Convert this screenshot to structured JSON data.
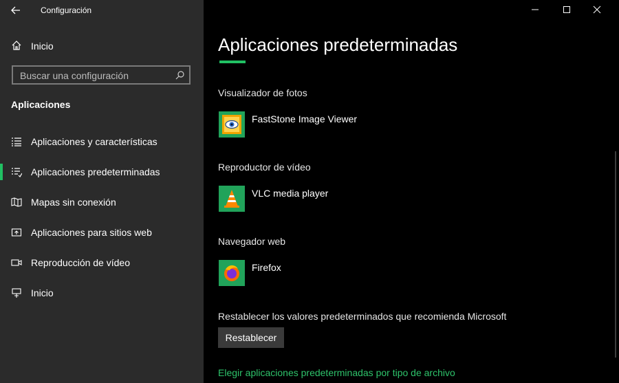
{
  "window": {
    "title": "Configuración",
    "controls": [
      "minimize",
      "maximize",
      "close"
    ]
  },
  "sidebar": {
    "home_label": "Inicio",
    "search": {
      "placeholder": "Buscar una configuración"
    },
    "section_title": "Aplicaciones",
    "items": [
      {
        "label": "Aplicaciones y características",
        "icon": "list-icon",
        "active": false
      },
      {
        "label": "Aplicaciones predeterminadas",
        "icon": "default-apps-icon",
        "active": true
      },
      {
        "label": "Mapas sin conexión",
        "icon": "map-icon",
        "active": false
      },
      {
        "label": "Aplicaciones para sitios web",
        "icon": "web-apps-icon",
        "active": false
      },
      {
        "label": "Reproducción de vídeo",
        "icon": "video-icon",
        "active": false
      },
      {
        "label": "Inicio",
        "icon": "startup-icon",
        "active": false
      }
    ]
  },
  "main": {
    "title": "Aplicaciones predeterminadas",
    "groups": [
      {
        "label": "Visualizador de fotos",
        "app": "FastStone Image Viewer",
        "icon": "faststone-eye-icon"
      },
      {
        "label": "Reproductor de vídeo",
        "app": "VLC media player",
        "icon": "vlc-cone-icon"
      },
      {
        "label": "Navegador web",
        "app": "Firefox",
        "icon": "firefox-icon"
      }
    ],
    "reset_label": "Restablecer los valores predeterminados que recomienda Microsoft",
    "reset_button": "Restablecer",
    "link": "Elegir aplicaciones predeterminadas por tipo de archivo"
  },
  "colors": {
    "accent": "#21c063",
    "sidebar_bg": "#2b2b2b",
    "main_bg": "#000000",
    "icon_tile": "#21a35a"
  }
}
